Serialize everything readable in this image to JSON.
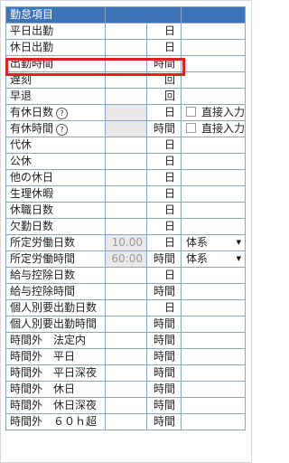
{
  "header": {
    "title": "勤怠項目",
    "col2": "",
    "col3": ""
  },
  "rows": [
    {
      "name": "平日出勤",
      "value": "",
      "unit": "日",
      "extra": ""
    },
    {
      "name": "休日出勤",
      "value": "",
      "unit": "日",
      "extra": ""
    },
    {
      "name": "出勤時間",
      "value": "",
      "unit": "時間",
      "extra": "",
      "highlighted": true
    },
    {
      "name": "遅刻",
      "value": "",
      "unit": "回",
      "extra": ""
    },
    {
      "name": "早退",
      "value": "",
      "unit": "回",
      "extra": ""
    },
    {
      "name": "有休日数",
      "help_icon": "question-circle-icon",
      "value": "",
      "unit": "日",
      "extra_checkbox": "直接入力",
      "checked": false
    },
    {
      "name": "有休時間",
      "help_icon": "question-circle-icon",
      "value": "",
      "unit": "時間",
      "extra_checkbox": "直接入力",
      "checked": false
    },
    {
      "name": "代休",
      "value": "",
      "unit": "日",
      "extra": ""
    },
    {
      "name": "公休",
      "value": "",
      "unit": "日",
      "extra": ""
    },
    {
      "name": "他の休日",
      "value": "",
      "unit": "日",
      "extra": ""
    },
    {
      "name": "生理休暇",
      "value": "",
      "unit": "日",
      "extra": ""
    },
    {
      "name": "休職日数",
      "value": "",
      "unit": "日",
      "extra": ""
    },
    {
      "name": "欠勤日数",
      "value": "",
      "unit": "日",
      "extra": ""
    },
    {
      "name": "所定労働日数",
      "value": "10.00",
      "unit": "日",
      "select": "体系"
    },
    {
      "name": "所定労働時間",
      "value": "60:00",
      "unit": "時間",
      "select": "体系"
    },
    {
      "name": "給与控除日数",
      "value": "",
      "unit": "日",
      "extra": ""
    },
    {
      "name": "給与控除時間",
      "value": "",
      "unit": "時間",
      "extra": ""
    },
    {
      "name": "個人別要出勤日数",
      "value": "",
      "unit": "日",
      "extra": ""
    },
    {
      "name": "個人別要出勤時間",
      "value": "",
      "unit": "時間",
      "extra": ""
    },
    {
      "name": "時間外　法定内",
      "value": "",
      "unit": "時間",
      "extra": ""
    },
    {
      "name": "時間外　平日",
      "value": "",
      "unit": "時間",
      "extra": ""
    },
    {
      "name": "時間外　平日深夜",
      "value": "",
      "unit": "時間",
      "extra": ""
    },
    {
      "name": "時間外　休日",
      "value": "",
      "unit": "時間",
      "extra": ""
    },
    {
      "name": "時間外　休日深夜",
      "value": "",
      "unit": "時間",
      "extra": ""
    },
    {
      "name": "時間外　６０ｈ超",
      "value": "",
      "unit": "時間",
      "extra": ""
    }
  ],
  "colors": {
    "header_bg": "#3f73b8",
    "grid": "#8aa4c8",
    "shaded": "#e9e9e9",
    "highlight": "#e02020"
  }
}
